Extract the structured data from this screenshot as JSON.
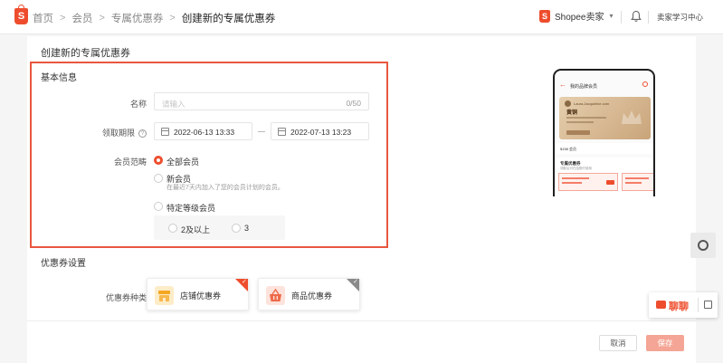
{
  "header": {
    "breadcrumbs": [
      "首页",
      "会员",
      "专属优惠券",
      "创建新的专属优惠券"
    ],
    "separator": ">",
    "logo_letter": "S",
    "seller_center": "Shopee卖家",
    "learning_center": "卖家学习中心"
  },
  "page": {
    "title": "创建新的专属优惠券"
  },
  "basic_info": {
    "section_title": "基本信息",
    "name_label": "名称",
    "name_placeholder": "请输入",
    "name_counter": "0/50",
    "period_label": "领取期限",
    "start_date": "2022-06-13 13:33",
    "end_date": "2022-07-13 13:23",
    "member_scope_label": "会员范畴",
    "options": {
      "all_members": "全部会员",
      "new_members": "新会员",
      "new_members_desc": "在最近7天内加入了您的会员计划的会员。",
      "specific_level": "特定等级会员",
      "level_a": "2及以上",
      "level_b": "3"
    },
    "selected_option": "all_members"
  },
  "voucher_settings": {
    "section_title": "优惠券设置",
    "type_label": "优惠券种类",
    "types": [
      "店铺优惠券",
      "商品优惠券"
    ],
    "selected_type": "店铺优惠券"
  },
  "footer": {
    "cancel": "取消",
    "save": "保存"
  },
  "preview": {
    "title": "我的品牌会员",
    "email": "Laura.Jacqueline.com",
    "level": "黄铜",
    "row_text": "$158 会员",
    "section_title": "专属优惠券",
    "section_sub": "领取后可在结账时使用"
  },
  "chat": {
    "label": "聊聊"
  },
  "colors": {
    "brand": "#ee4d2d",
    "highlight_border": "#e8573f",
    "save_disabled": "#f5a595"
  }
}
